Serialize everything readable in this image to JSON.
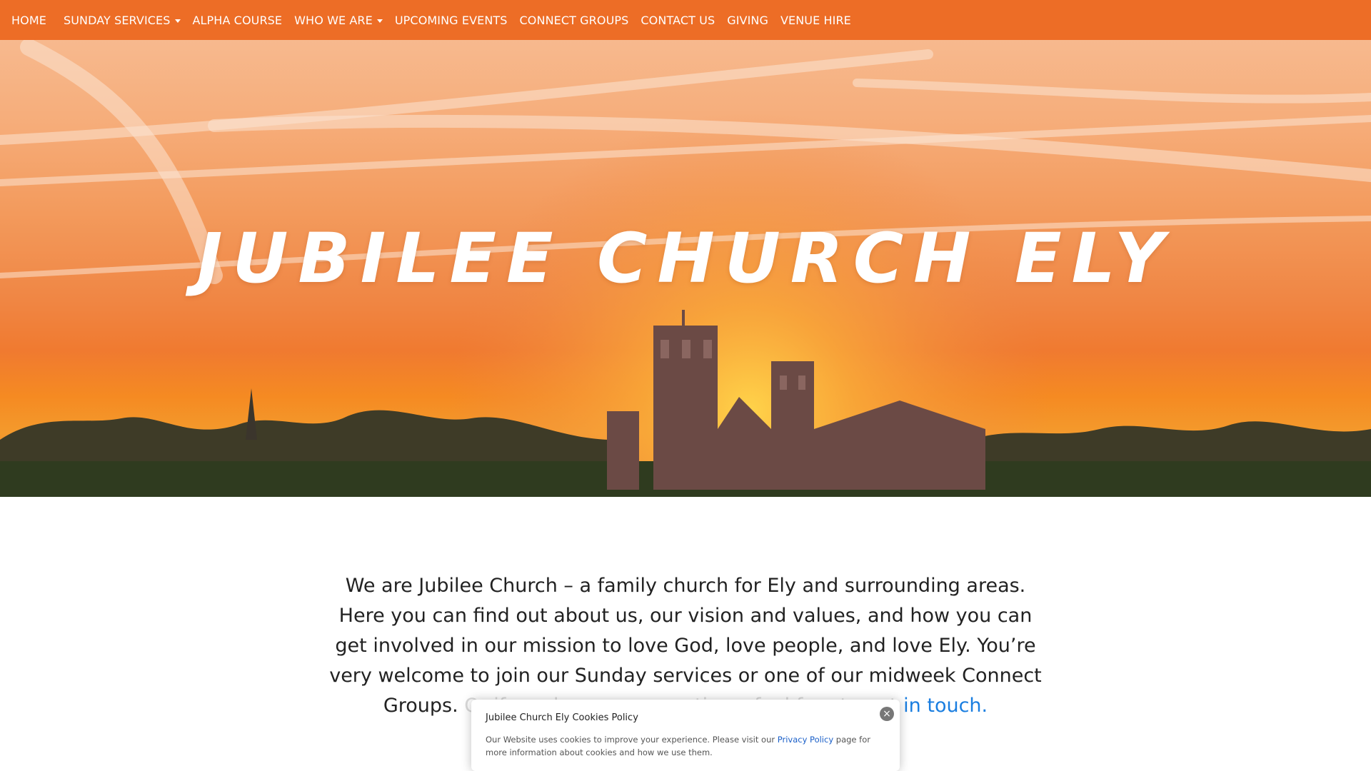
{
  "nav": {
    "items": [
      {
        "label": "HOME",
        "dropdown": false
      },
      {
        "label": "SUNDAY SERVICES",
        "dropdown": true
      },
      {
        "label": "ALPHA COURSE",
        "dropdown": false
      },
      {
        "label": "WHO WE ARE",
        "dropdown": true
      },
      {
        "label": "UPCOMING EVENTS",
        "dropdown": false
      },
      {
        "label": "CONNECT GROUPS",
        "dropdown": false
      },
      {
        "label": "CONTACT US",
        "dropdown": false
      },
      {
        "label": "GIVING",
        "dropdown": false
      },
      {
        "label": "VENUE HIRE",
        "dropdown": false
      }
    ],
    "background": "#ed6d26"
  },
  "hero": {
    "title": "Jubilee Church Ely"
  },
  "intro": {
    "text_main": "We are Jubilee Church – a family church for Ely and surrounding areas. Here you can find out about us, our vision and values, and how you can get involved in our mission to love God, love people, and love Ely. You’re very welcome to join our Sunday services or one of our midweek Connect Groups.",
    "text_faded": " Or if you have any questions, feel free to ",
    "link_faded": "get ",
    "link_text": "in touch."
  },
  "cookie": {
    "title": "Jubilee Church Ely Cookies Policy",
    "text_before": "Our Website uses cookies to improve your experience. Please visit our ",
    "link": "Privacy Policy",
    "text_after": " page for more information about cookies and how we use them.",
    "close": "×"
  },
  "colors": {
    "accent": "#ed6d26",
    "link": "#1a7ee0"
  },
  "icons": {
    "dropdown": "caret-down-icon",
    "close": "close-icon"
  }
}
